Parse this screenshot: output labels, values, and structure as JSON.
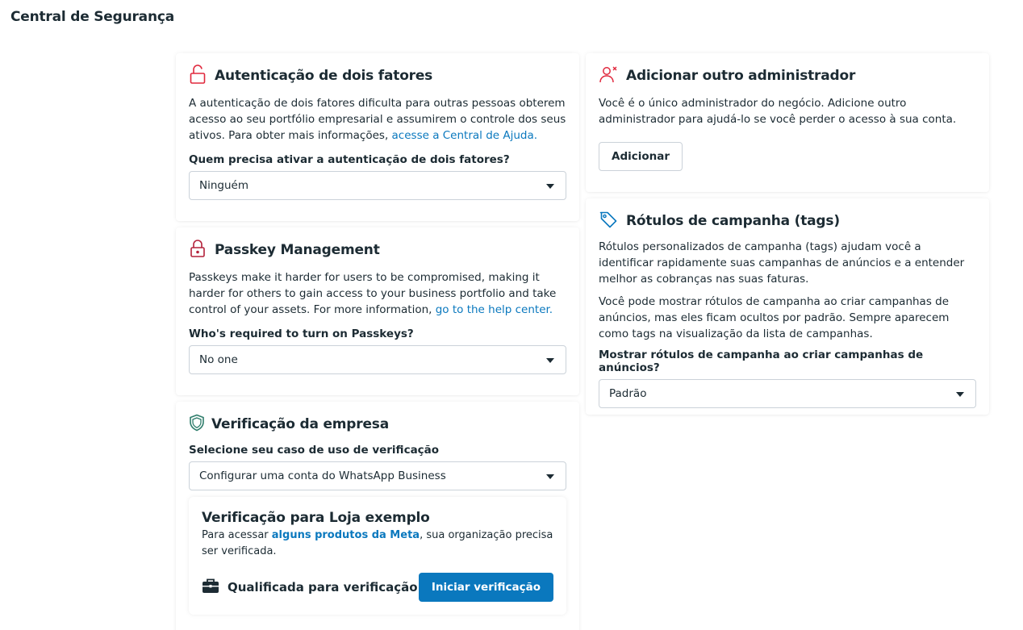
{
  "page": {
    "title": "Central de Segurança"
  },
  "two_factor": {
    "title": "Autenticação de dois fatores",
    "description": "A autenticação de dois fatores dificulta para outras pessoas obterem acesso ao seu portfólio empresarial e assumirem o controle dos seus ativos. Para obter mais informações, ",
    "link": "acesse a Central de Ajuda.",
    "question": "Quem precisa ativar a autenticação de dois fatores?",
    "selected": "Ninguém",
    "icon": "unlock-icon"
  },
  "passkey": {
    "title": "Passkey Management",
    "description": "Passkeys make it harder for users to be compromised, making it harder for others to gain access to your business portfolio and take control of your assets. For more information, ",
    "link": "go to the help center.",
    "question": "Who's required to turn on Passkeys?",
    "selected": "No one",
    "icon": "padlock-icon"
  },
  "verification": {
    "title": "Verificação da empresa",
    "label": "Selecione seu caso de uso de verificação",
    "selected": "Configurar uma conta do WhatsApp Business",
    "inner": {
      "title": "Verificação para Loja exemplo",
      "text_before": "Para acessar ",
      "link": "alguns produtos da Meta",
      "text_after": ", sua organização precisa ser verificada.",
      "status": "Qualificada para verificação",
      "button": "Iniciar verificação"
    },
    "icon": "shield-icon"
  },
  "admin": {
    "title": "Adicionar outro administrador",
    "description": "Você é o único administrador do negócio. Adicione outro administrador para ajudá-lo se você perder o acesso à sua conta.",
    "button": "Adicionar",
    "icon": "person-x-icon"
  },
  "tags": {
    "title": "Rótulos de campanha (tags)",
    "description1": "Rótulos personalizados de campanha (tags) ajudam você a identificar rapidamente suas campanhas de anúncios e a entender melhor as cobranças nas suas faturas.",
    "description2": "Você pode mostrar rótulos de campanha ao criar campanhas de anúncios, mas eles ficam ocultos por padrão. Sempre aparecem como tags na visualização da lista de campanhas.",
    "question": "Mostrar rótulos de campanha ao criar campanhas de anúncios?",
    "selected": "Padrão",
    "icon": "tag-icon"
  },
  "colors": {
    "accent": "#0a78be",
    "danger": "#e0283d",
    "shield": "#2e7d6b",
    "text": "#1c2b33"
  }
}
